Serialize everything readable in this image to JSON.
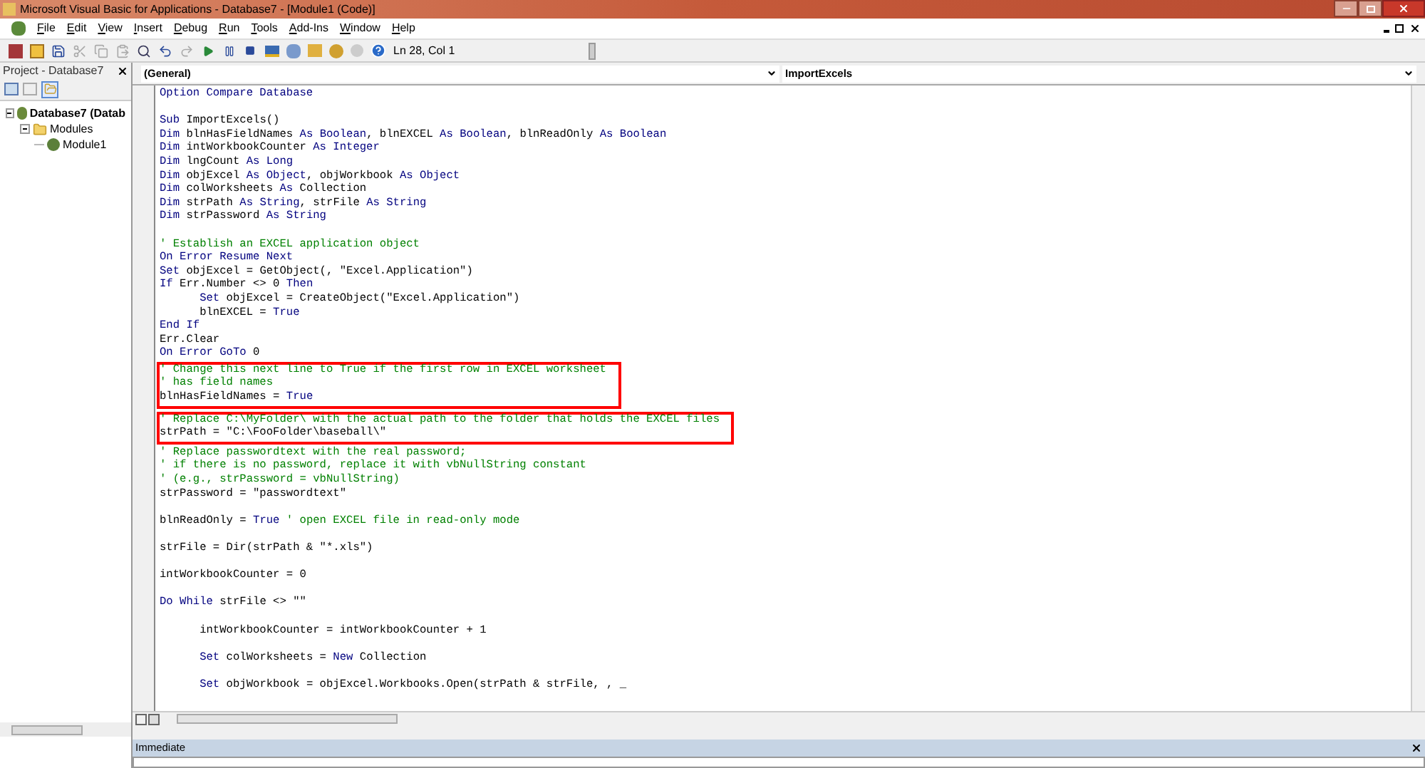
{
  "window": {
    "title": "Microsoft Visual Basic for Applications - Database7 - [Module1 (Code)]"
  },
  "menu": [
    "File",
    "Edit",
    "View",
    "Insert",
    "Debug",
    "Run",
    "Tools",
    "Add-Ins",
    "Window",
    "Help"
  ],
  "toolbar": {
    "position": "Ln 28, Col 1"
  },
  "project": {
    "title": "Project - Database7",
    "tree": [
      {
        "label": "Database7 (Datab",
        "kind": "project",
        "expanded": true,
        "children": [
          {
            "label": "Modules",
            "kind": "folder",
            "expanded": true,
            "children": [
              {
                "label": "Module1",
                "kind": "module"
              }
            ]
          }
        ]
      }
    ]
  },
  "code_window": {
    "object_dropdown": "(General)",
    "procedure_dropdown": "ImportExcels",
    "blocks": [
      {
        "boxed": false,
        "lines": [
          [
            {
              "kind": "kw",
              "text": "Option Compare Database"
            }
          ],
          [
            {
              "kind": "blank"
            }
          ],
          [
            {
              "kind": "kw",
              "text": "Sub"
            },
            {
              "kind": "plain",
              "text": " ImportExcels()"
            }
          ],
          [
            {
              "kind": "kw",
              "text": "Dim"
            },
            {
              "kind": "plain",
              "text": " blnHasFieldNames "
            },
            {
              "kind": "kw",
              "text": "As Boolean"
            },
            {
              "kind": "plain",
              "text": ", blnEXCEL "
            },
            {
              "kind": "kw",
              "text": "As Boolean"
            },
            {
              "kind": "plain",
              "text": ", blnReadOnly "
            },
            {
              "kind": "kw",
              "text": "As Boolean"
            }
          ],
          [
            {
              "kind": "kw",
              "text": "Dim"
            },
            {
              "kind": "plain",
              "text": " intWorkbookCounter "
            },
            {
              "kind": "kw",
              "text": "As Integer"
            }
          ],
          [
            {
              "kind": "kw",
              "text": "Dim"
            },
            {
              "kind": "plain",
              "text": " lngCount "
            },
            {
              "kind": "kw",
              "text": "As Long"
            }
          ],
          [
            {
              "kind": "kw",
              "text": "Dim"
            },
            {
              "kind": "plain",
              "text": " objExcel "
            },
            {
              "kind": "kw",
              "text": "As Object"
            },
            {
              "kind": "plain",
              "text": ", objWorkbook "
            },
            {
              "kind": "kw",
              "text": "As Object"
            }
          ],
          [
            {
              "kind": "kw",
              "text": "Dim"
            },
            {
              "kind": "plain",
              "text": " colWorksheets "
            },
            {
              "kind": "kw",
              "text": "As"
            },
            {
              "kind": "plain",
              "text": " Collection"
            }
          ],
          [
            {
              "kind": "kw",
              "text": "Dim"
            },
            {
              "kind": "plain",
              "text": " strPath "
            },
            {
              "kind": "kw",
              "text": "As String"
            },
            {
              "kind": "plain",
              "text": ", strFile "
            },
            {
              "kind": "kw",
              "text": "As String"
            }
          ],
          [
            {
              "kind": "kw",
              "text": "Dim"
            },
            {
              "kind": "plain",
              "text": " strPassword "
            },
            {
              "kind": "kw",
              "text": "As String"
            }
          ],
          [
            {
              "kind": "blank"
            }
          ],
          [
            {
              "kind": "comment",
              "text": "' Establish an EXCEL application object"
            }
          ],
          [
            {
              "kind": "kw",
              "text": "On Error Resume Next"
            }
          ],
          [
            {
              "kind": "kw",
              "text": "Set"
            },
            {
              "kind": "plain",
              "text": " objExcel = GetObject(, \"Excel.Application\")"
            }
          ],
          [
            {
              "kind": "kw",
              "text": "If"
            },
            {
              "kind": "plain",
              "text": " Err.Number <> 0 "
            },
            {
              "kind": "kw",
              "text": "Then"
            }
          ],
          [
            {
              "kind": "kw",
              "text": "      Set"
            },
            {
              "kind": "plain",
              "text": " objExcel = CreateObject(\"Excel.Application\")"
            }
          ],
          [
            {
              "kind": "plain",
              "text": "      blnEXCEL = "
            },
            {
              "kind": "kw",
              "text": "True"
            }
          ],
          [
            {
              "kind": "kw",
              "text": "End If"
            }
          ],
          [
            {
              "kind": "plain",
              "text": "Err.Clear"
            }
          ],
          [
            {
              "kind": "kw",
              "text": "On Error GoTo"
            },
            {
              "kind": "plain",
              "text": " 0"
            }
          ]
        ]
      },
      {
        "boxed": true,
        "lines": [
          [
            {
              "kind": "comment",
              "text": "' Change this next line to True if the first row in EXCEL worksheet"
            }
          ],
          [
            {
              "kind": "comment",
              "text": "' has field names"
            }
          ],
          [
            {
              "kind": "plain",
              "text": "blnHasFieldNames = "
            },
            {
              "kind": "kw",
              "text": "True"
            }
          ]
        ]
      },
      {
        "boxed": true,
        "lines": [
          [
            {
              "kind": "comment",
              "text": "' Replace C:\\MyFolder\\ with the actual path to the folder that holds the EXCEL files"
            }
          ],
          [
            {
              "kind": "plain",
              "text": "strPath = \"C:\\FooFolder\\baseball\\\""
            }
          ]
        ]
      },
      {
        "boxed": false,
        "lines": [
          [
            {
              "kind": "comment",
              "text": "' Replace passwordtext with the real password;"
            }
          ],
          [
            {
              "kind": "comment",
              "text": "' if there is no password, replace it with vbNullString constant"
            }
          ],
          [
            {
              "kind": "comment",
              "text": "' (e.g., strPassword = vbNullString)"
            }
          ],
          [
            {
              "kind": "plain",
              "text": "strPassword = \"passwordtext\""
            }
          ],
          [
            {
              "kind": "blank"
            }
          ],
          [
            {
              "kind": "plain",
              "text": "blnReadOnly = "
            },
            {
              "kind": "kw",
              "text": "True"
            },
            {
              "kind": "comment",
              "text": " ' open EXCEL file in read-only mode"
            }
          ],
          [
            {
              "kind": "blank"
            }
          ],
          [
            {
              "kind": "plain",
              "text": "strFile = Dir(strPath & \"*.xls\")"
            }
          ],
          [
            {
              "kind": "blank"
            }
          ],
          [
            {
              "kind": "plain",
              "text": "intWorkbookCounter = 0"
            }
          ],
          [
            {
              "kind": "blank"
            }
          ],
          [
            {
              "kind": "kw",
              "text": "Do While"
            },
            {
              "kind": "plain",
              "text": " strFile <> \"\""
            }
          ],
          [
            {
              "kind": "blank"
            }
          ],
          [
            {
              "kind": "plain",
              "text": "      intWorkbookCounter = intWorkbookCounter + 1"
            }
          ],
          [
            {
              "kind": "blank"
            }
          ],
          [
            {
              "kind": "kw",
              "text": "      Set"
            },
            {
              "kind": "plain",
              "text": " colWorksheets = "
            },
            {
              "kind": "kw",
              "text": "New"
            },
            {
              "kind": "plain",
              "text": " Collection"
            }
          ],
          [
            {
              "kind": "blank"
            }
          ],
          [
            {
              "kind": "kw",
              "text": "      Set"
            },
            {
              "kind": "plain",
              "text": " objWorkbook = objExcel.Workbooks.Open(strPath & strFile, , _"
            }
          ]
        ]
      }
    ]
  },
  "immediate": {
    "title": "Immediate"
  }
}
